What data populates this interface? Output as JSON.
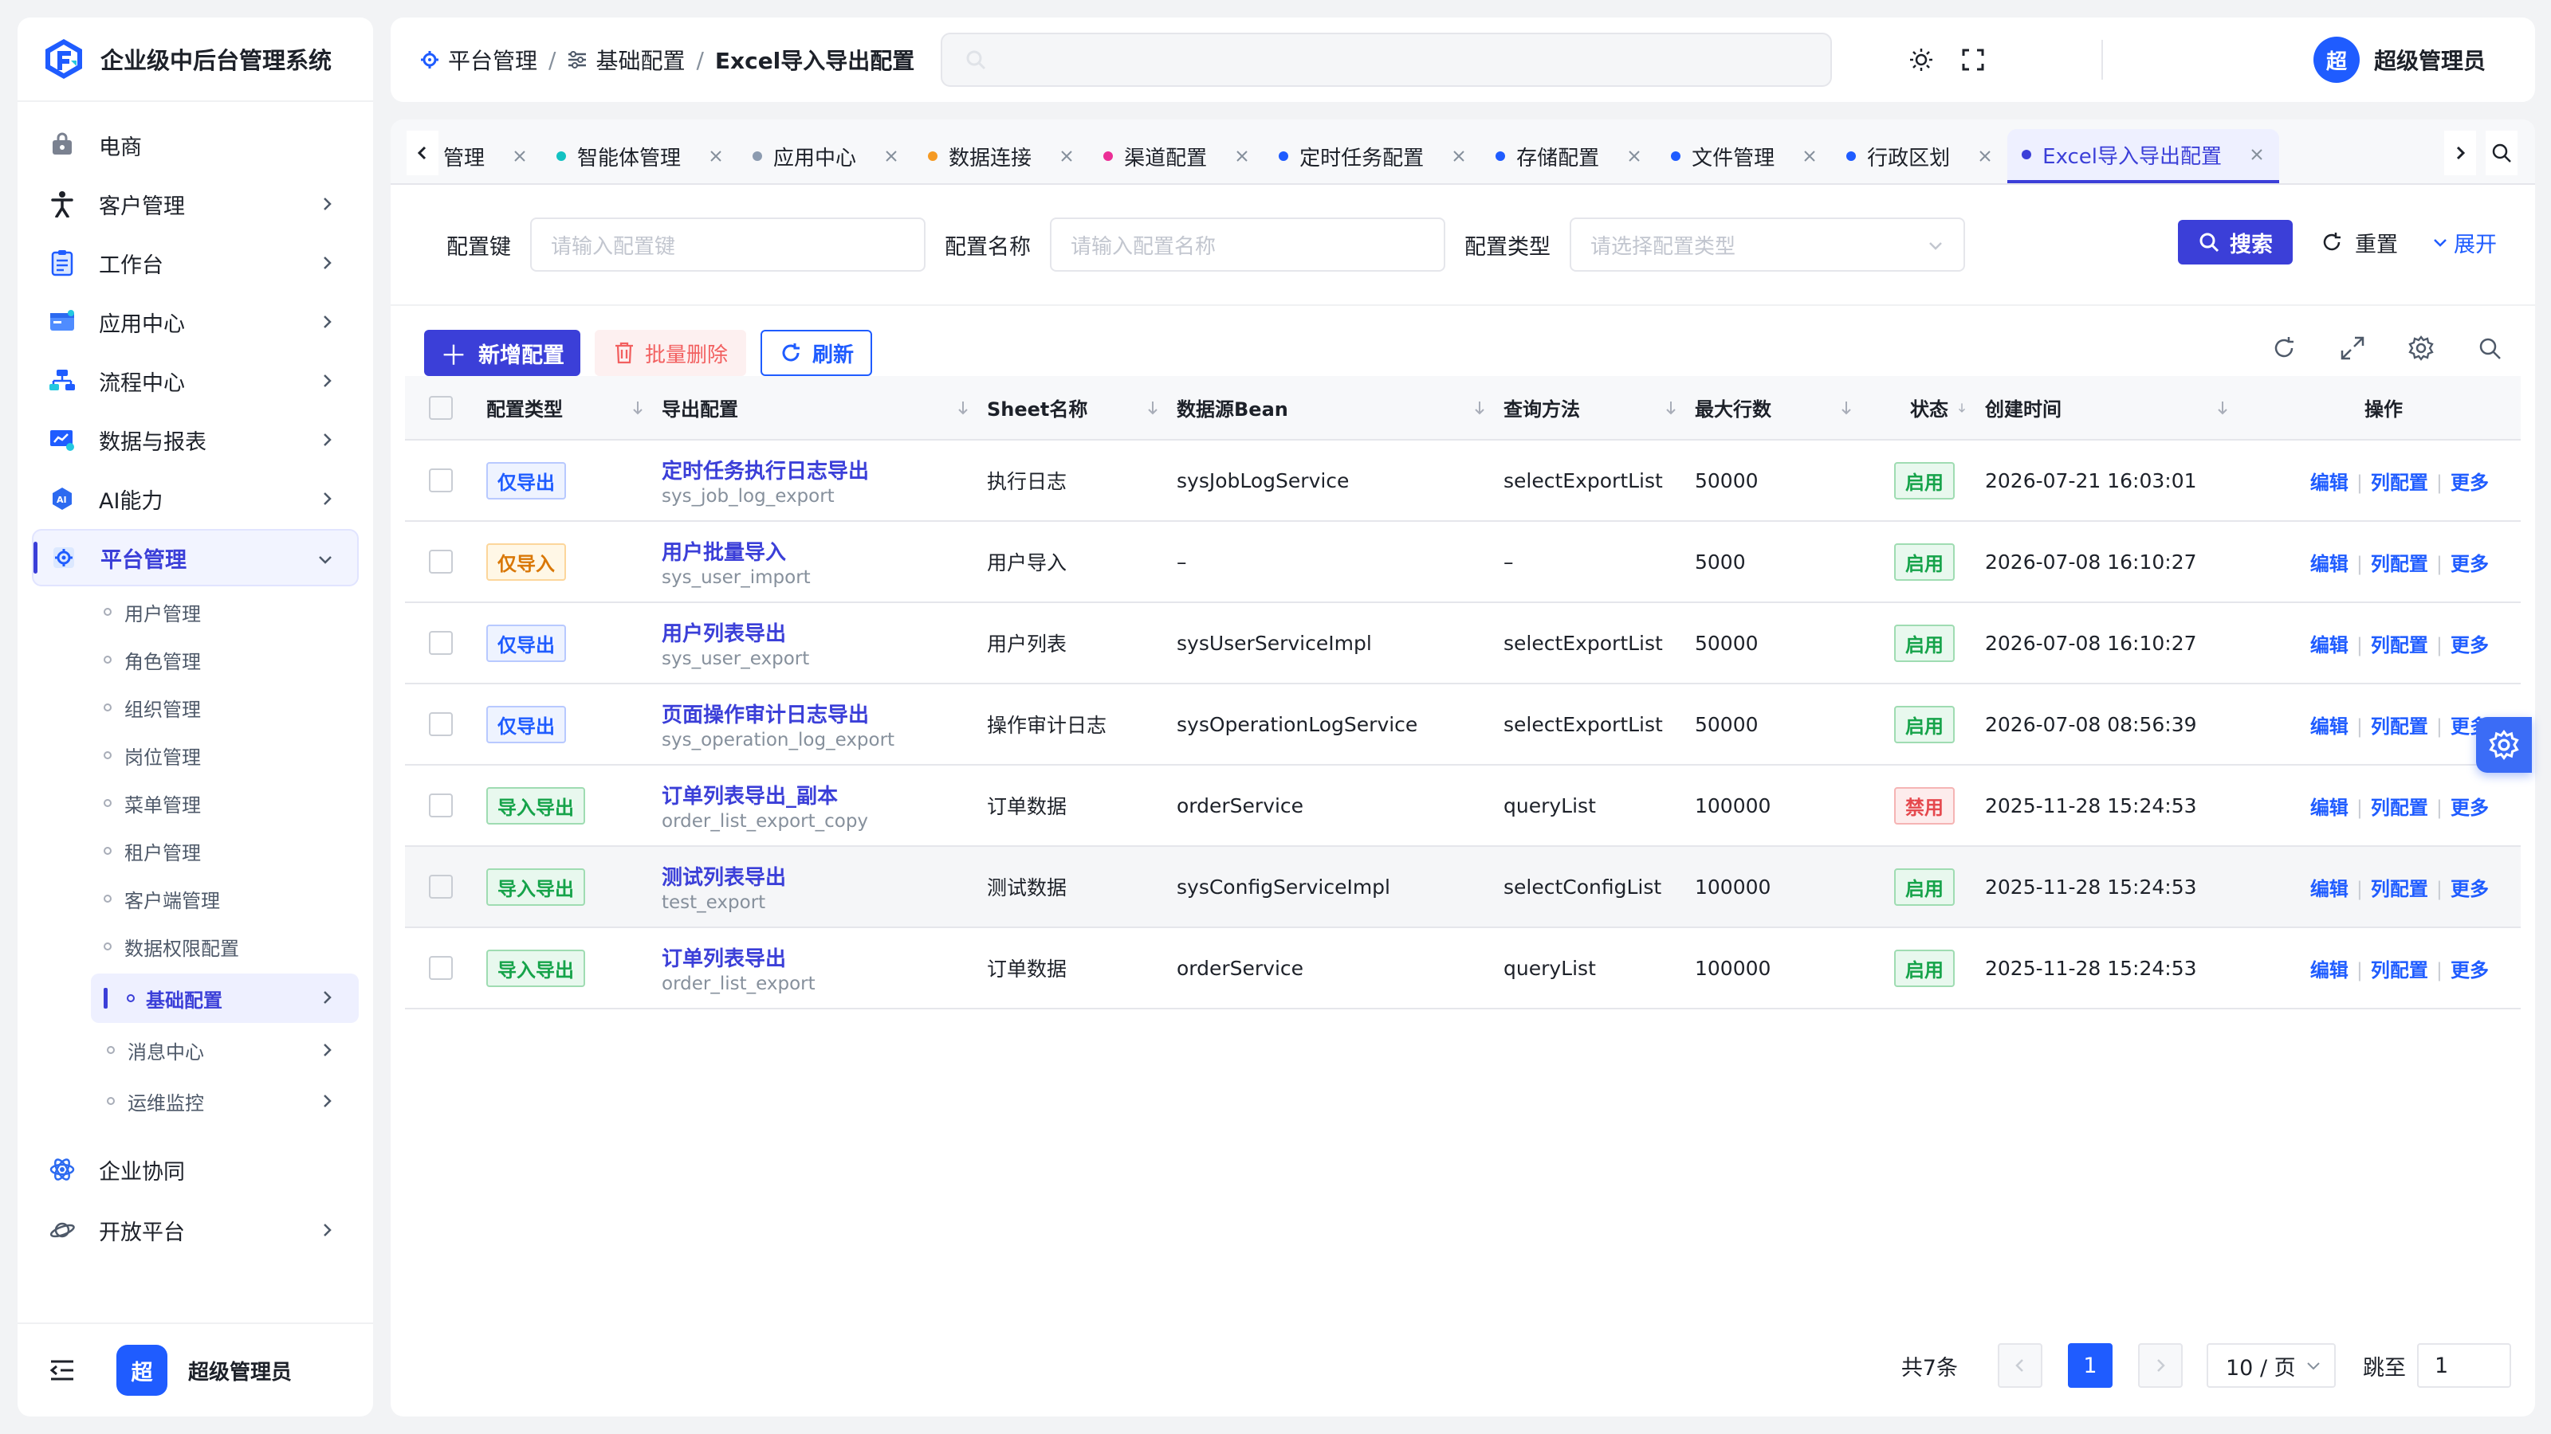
{
  "app": {
    "title": "企业级中后台管理系统",
    "user": "超级管理员",
    "avatar_char": "超"
  },
  "sidebar": {
    "items": [
      {
        "label": "电商",
        "icon": "bag-icon"
      },
      {
        "label": "客户管理",
        "icon": "person-icon"
      },
      {
        "label": "工作台",
        "icon": "clipboard-icon"
      },
      {
        "label": "应用中心",
        "icon": "app-window-icon"
      },
      {
        "label": "流程中心",
        "icon": "flow-icon"
      },
      {
        "label": "数据与报表",
        "icon": "report-icon"
      },
      {
        "label": "AI能力",
        "icon": "ai-icon"
      },
      {
        "label": "平台管理",
        "icon": "platform-gear-icon"
      }
    ],
    "sub_items": [
      "用户管理",
      "角色管理",
      "组织管理",
      "岗位管理",
      "菜单管理",
      "租户管理",
      "客户端管理",
      "数据权限配置",
      "基础配置",
      "消息中心",
      "运维监控"
    ],
    "bottom_items": [
      {
        "label": "企业协同",
        "icon": "atom-icon"
      },
      {
        "label": "开放平台",
        "icon": "planet-icon"
      }
    ]
  },
  "breadcrumb": {
    "root": "平台管理",
    "mid": "基础配置",
    "current": "Excel导入导出配置"
  },
  "tabs": [
    {
      "label": "管理",
      "color": "none"
    },
    {
      "label": "智能体管理",
      "color": "#13c2c2"
    },
    {
      "label": "应用中心",
      "color": "#8c9bb0"
    },
    {
      "label": "数据连接",
      "color": "#f59a23"
    },
    {
      "label": "渠道配置",
      "color": "#eb2f96"
    },
    {
      "label": "定时任务配置",
      "color": "#1f5cff"
    },
    {
      "label": "存储配置",
      "color": "#1f5cff"
    },
    {
      "label": "文件管理",
      "color": "#1f5cff"
    },
    {
      "label": "行政区划",
      "color": "#1f5cff"
    },
    {
      "label": "Excel导入导出配置",
      "color": "#3b3fd8"
    }
  ],
  "filters": {
    "key_label": "配置键",
    "key_placeholder": "请输入配置键",
    "name_label": "配置名称",
    "name_placeholder": "请输入配置名称",
    "type_label": "配置类型",
    "type_placeholder": "请选择配置类型",
    "search": "搜索",
    "reset": "重置",
    "expand": "展开"
  },
  "toolbar": {
    "add": "新增配置",
    "batch_delete": "批量删除",
    "refresh": "刷新"
  },
  "table": {
    "headers": [
      "配置类型",
      "导出配置",
      "Sheet名称",
      "数据源Bean",
      "查询方法",
      "最大行数",
      "状态",
      "创建时间",
      "操作"
    ],
    "rows": [
      {
        "type": "仅导出",
        "type_class": "exp",
        "name": "定时任务执行日志导出",
        "code": "sys_job_log_export",
        "sheet": "执行日志",
        "bean": "sysJobLogService",
        "method": "selectExportList",
        "max": "50000",
        "status": "启用",
        "status_class": "on",
        "time": "2026-07-21 16:03:01"
      },
      {
        "type": "仅导入",
        "type_class": "imp",
        "name": "用户批量导入",
        "code": "sys_user_import",
        "sheet": "用户导入",
        "bean": "–",
        "method": "–",
        "max": "5000",
        "status": "启用",
        "status_class": "on",
        "time": "2026-07-08 16:10:27"
      },
      {
        "type": "仅导出",
        "type_class": "exp",
        "name": "用户列表导出",
        "code": "sys_user_export",
        "sheet": "用户列表",
        "bean": "sysUserServiceImpl",
        "method": "selectExportList",
        "max": "50000",
        "status": "启用",
        "status_class": "on",
        "time": "2026-07-08 16:10:27"
      },
      {
        "type": "仅导出",
        "type_class": "exp",
        "name": "页面操作审计日志导出",
        "code": "sys_operation_log_export",
        "sheet": "操作审计日志",
        "bean": "sysOperationLogService",
        "method": "selectExportList",
        "max": "50000",
        "status": "启用",
        "status_class": "on",
        "time": "2026-07-08 08:56:39"
      },
      {
        "type": "导入导出",
        "type_class": "both",
        "name": "订单列表导出_副本",
        "code": "order_list_export_copy",
        "sheet": "订单数据",
        "bean": "orderService",
        "method": "queryList",
        "max": "100000",
        "status": "禁用",
        "status_class": "off",
        "time": "2025-11-28 15:24:53"
      },
      {
        "type": "导入导出",
        "type_class": "both",
        "name": "测试列表导出",
        "code": "test_export",
        "sheet": "测试数据",
        "bean": "sysConfigServiceImpl",
        "method": "selectConfigList",
        "max": "100000",
        "status": "启用",
        "status_class": "on",
        "time": "2025-11-28 15:24:53"
      },
      {
        "type": "导入导出",
        "type_class": "both",
        "name": "订单列表导出",
        "code": "order_list_export",
        "sheet": "订单数据",
        "bean": "orderService",
        "method": "queryList",
        "max": "100000",
        "status": "启用",
        "status_class": "on",
        "time": "2025-11-28 15:24:53"
      }
    ],
    "ops": {
      "edit": "编辑",
      "columns": "列配置",
      "more": "更多"
    }
  },
  "pagination": {
    "total": "共7条",
    "page": "1",
    "size": "10 / 页",
    "jump_label": "跳至",
    "jump_value": "1"
  }
}
